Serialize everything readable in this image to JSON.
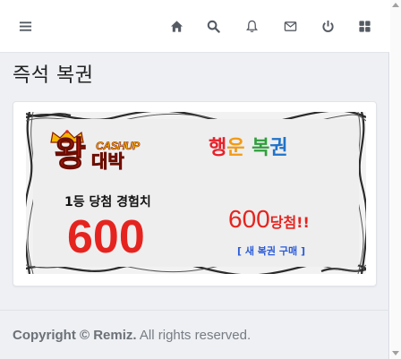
{
  "topbar": {
    "icons": [
      "menu-icon",
      "home-icon",
      "search-icon",
      "bell-icon",
      "envelope-icon",
      "power-icon",
      "grid-icon"
    ]
  },
  "page": {
    "title": "즉석 복권"
  },
  "ticket": {
    "logo": {
      "cashup": "CASHUP",
      "wang": "왕",
      "daebak": "대박"
    },
    "lucky_title": {
      "w1": "행",
      "w2": "운",
      "w3": "복",
      "w4": "권"
    },
    "record_label": "1등 당첨 경험치",
    "record_value": "600",
    "win_number": "600",
    "win_text": "당첨!!",
    "buy_link": "[ 새 복권 구매 ]"
  },
  "footer": {
    "prefix": "Copyright © ",
    "brand": "Remiz.",
    "suffix": " All rights reserved."
  },
  "colors": {
    "accent_red": "#e5241f",
    "link_blue": "#2a5bd7",
    "icon_gray": "#555b63",
    "background": "#eef0f3"
  }
}
